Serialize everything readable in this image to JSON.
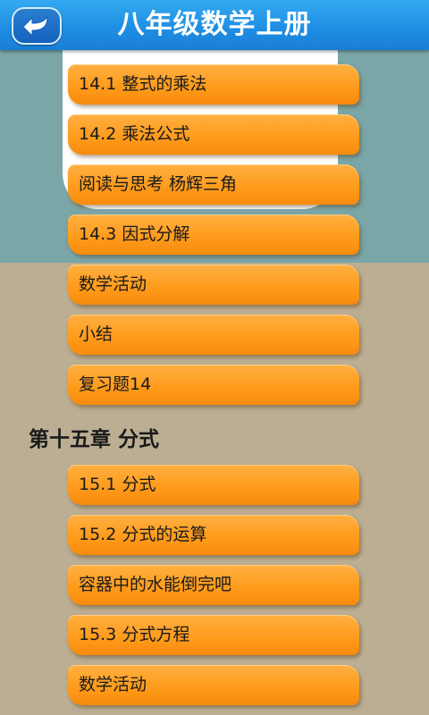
{
  "header": {
    "title": "八年级数学上册",
    "back_icon": "back-arrow-icon"
  },
  "colors": {
    "header_blue": "#1f8fe3",
    "item_orange": "#ff9a1a",
    "background_teal": "#7aa6a8",
    "background_paper": "#bbae93"
  },
  "section_a": {
    "items": [
      {
        "label": "14.1 整式的乘法"
      },
      {
        "label": "14.2 乘法公式"
      },
      {
        "label": "阅读与思考 杨辉三角"
      },
      {
        "label": "14.3 因式分解"
      },
      {
        "label": "数学活动"
      },
      {
        "label": "小结"
      },
      {
        "label": "复习题14"
      }
    ]
  },
  "chapter_15": {
    "title": "第十五章 分式",
    "items": [
      {
        "label": "15.1 分式"
      },
      {
        "label": "15.2 分式的运算"
      },
      {
        "label": "容器中的水能倒完吧"
      },
      {
        "label": "15.3 分式方程"
      },
      {
        "label": "数学活动"
      }
    ]
  }
}
